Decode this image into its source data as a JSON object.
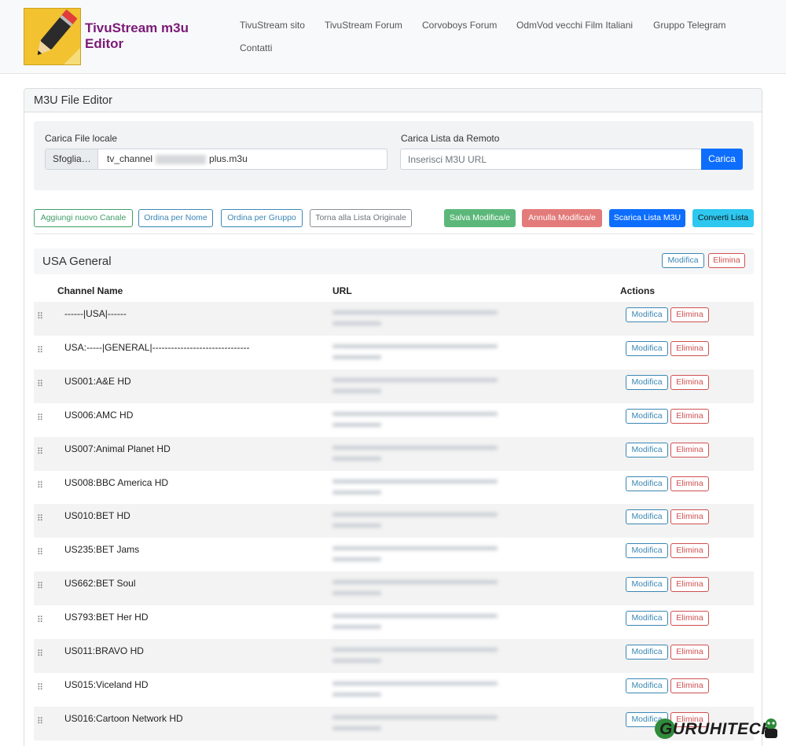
{
  "brand": {
    "title": "TivuStream m3u Editor"
  },
  "nav": {
    "links": [
      "TivuStream sito",
      "TivuStream Forum",
      "Corvoboys Forum",
      "OdmVod vecchi Film Italiani",
      "Gruppo Telegram",
      "Contatti"
    ]
  },
  "card": {
    "title": "M3U File Editor"
  },
  "local": {
    "label": "Carica File locale",
    "browse_label": "Sfoglia…",
    "file_name": "tv_channel",
    "file_name_end": "plus.m3u"
  },
  "remote": {
    "label": "Carica Lista da Remoto",
    "placeholder": "Inserisci M3U URL",
    "load_label": "Carica"
  },
  "toolbar": {
    "add_channel": "Aggiungi nuovo Canale",
    "sort_name": "Ordina per Nome",
    "sort_group": "Ordina per Gruppo",
    "revert": "Torna alla Lista Originale",
    "save": "Salva Modifica/e",
    "cancel": "Annulla Modifica/e",
    "download": "Scarica Lista M3U",
    "convert": "Converti Lista"
  },
  "group": {
    "name": "USA General",
    "edit_label": "Modifica",
    "delete_label": "Elimina"
  },
  "table": {
    "headers": [
      "Channel Name",
      "URL",
      "Actions"
    ],
    "edit_label": "Modifica",
    "delete_label": "Elimina",
    "rows": [
      {
        "name": "------|USA|------"
      },
      {
        "name": "USA:-----|GENERAL|-------------------------------"
      },
      {
        "name": "US001:A&E HD"
      },
      {
        "name": "US006:AMC HD"
      },
      {
        "name": "US007:Animal Planet HD"
      },
      {
        "name": "US008:BBC America HD"
      },
      {
        "name": "US010:BET HD"
      },
      {
        "name": "US235:BET Jams"
      },
      {
        "name": "US662:BET Soul"
      },
      {
        "name": "US793:BET Her HD"
      },
      {
        "name": "US011:BRAVO HD"
      },
      {
        "name": "US015:Viceland HD"
      },
      {
        "name": "US016:Cartoon Network HD"
      },
      {
        "name": ""
      }
    ]
  },
  "watermark": {
    "text": "GURUHITECH"
  },
  "colors": {
    "brand_purple": "#7a1a78",
    "primary": "#0d6efd",
    "success": "#5cb87a",
    "danger": "#e37b7b",
    "info": "#2ec7ef",
    "outline_blue": "#3a87b4",
    "outline_red": "#d05050",
    "outline_green": "#3f9d67"
  }
}
